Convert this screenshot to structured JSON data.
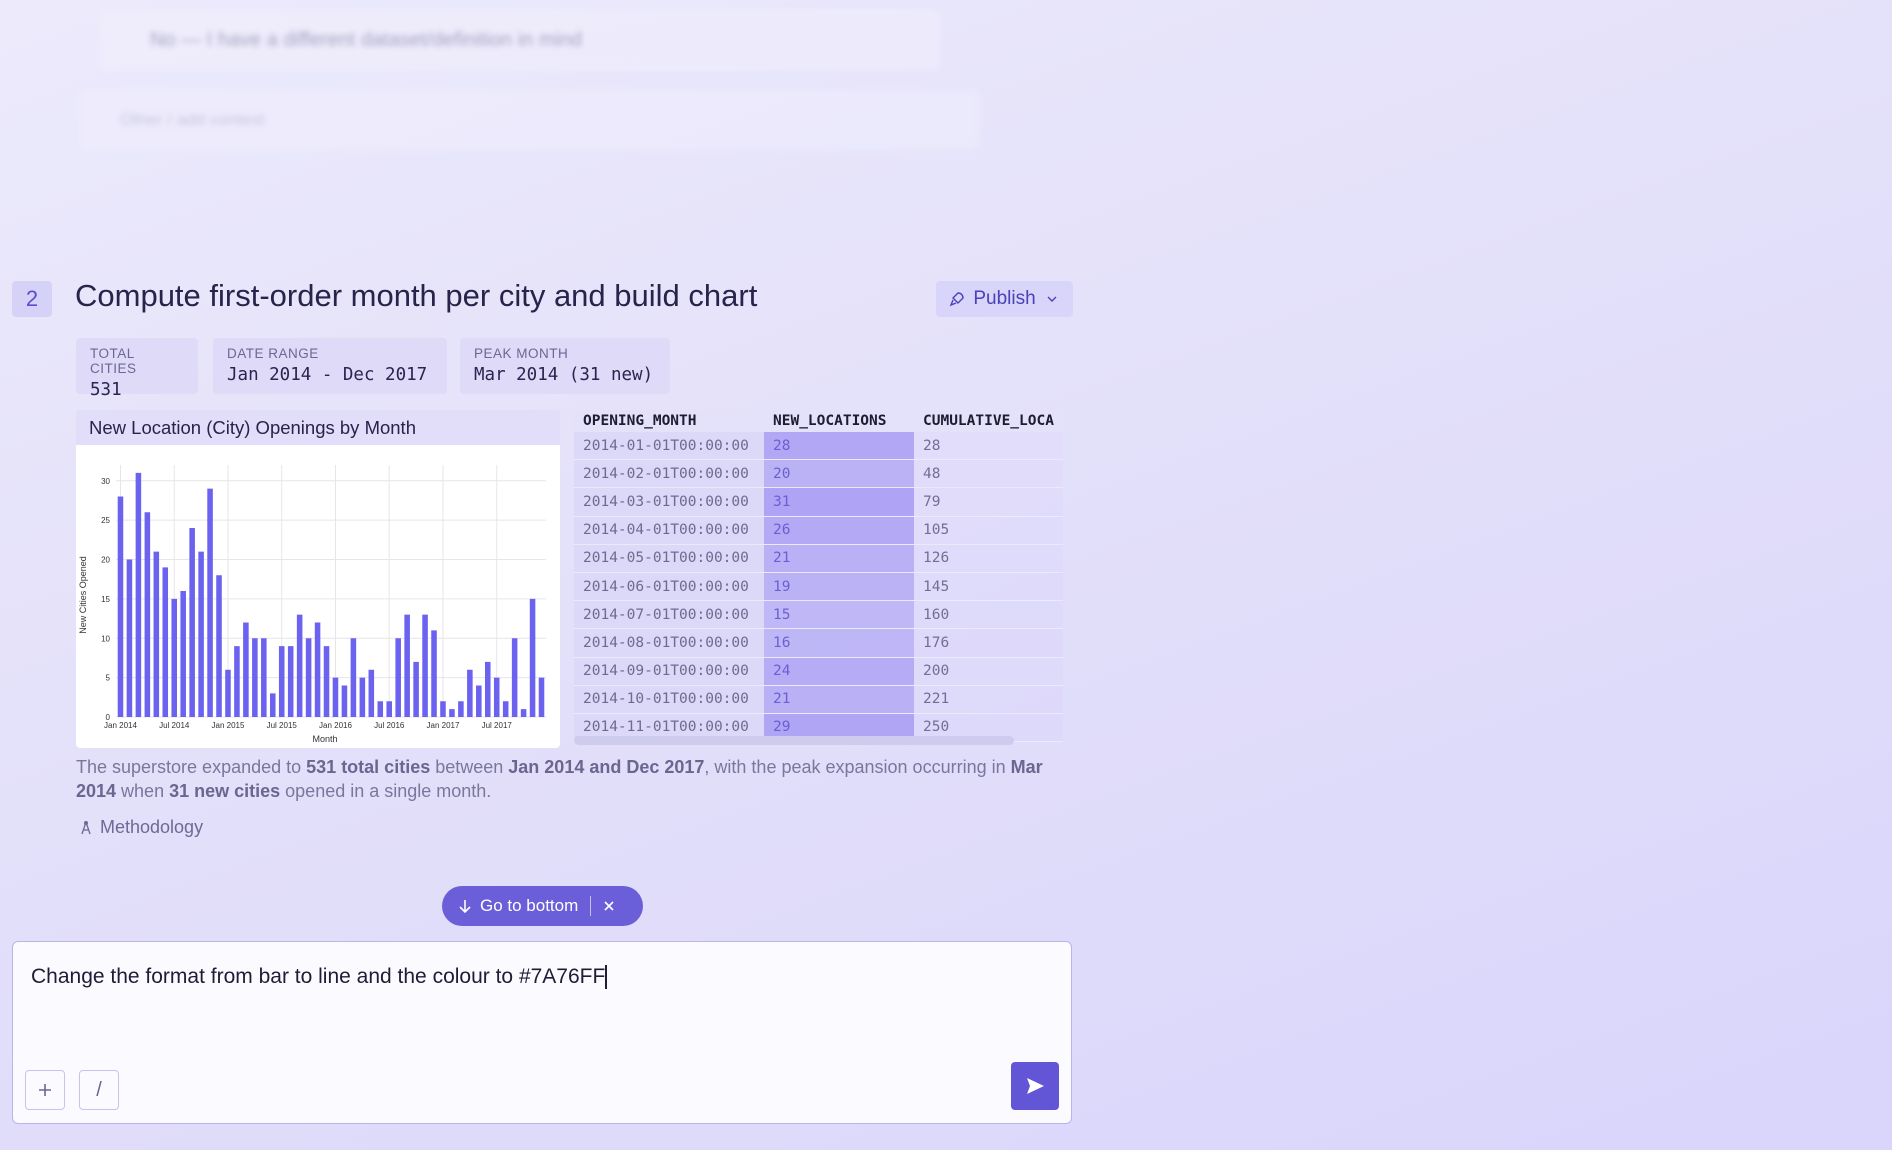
{
  "background": {
    "option_text": "No — I have a different dataset/definition in mind",
    "other_text": "Other / add context"
  },
  "step": {
    "number": "2",
    "title": "Compute first-order month per city and build chart",
    "publish_label": "Publish"
  },
  "stats": [
    {
      "label": "TOTAL CITIES",
      "value": "531"
    },
    {
      "label": "DATE RANGE",
      "value": "Jan 2014 - Dec 2017"
    },
    {
      "label": "PEAK MONTH",
      "value": "Mar 2014 (31 new)"
    }
  ],
  "chart_title": "New Location (City) Openings by Month",
  "chart_data": {
    "type": "bar",
    "title": "New Location (City) Openings by Month",
    "xlabel": "Month",
    "ylabel": "New Cities Opened",
    "ylim": [
      0,
      32
    ],
    "yticks": [
      0,
      5,
      10,
      15,
      20,
      25,
      30
    ],
    "xticks": [
      "Jan 2014",
      "Jul 2014",
      "Jan 2015",
      "Jul 2015",
      "Jan 2016",
      "Jul 2016",
      "Jan 2017",
      "Jul 2017"
    ],
    "values": [
      28,
      20,
      31,
      26,
      21,
      19,
      15,
      16,
      24,
      21,
      29,
      18,
      6,
      9,
      12,
      10,
      10,
      3,
      9,
      9,
      13,
      10,
      12,
      9,
      5,
      4,
      10,
      5,
      6,
      2,
      2,
      10,
      13,
      7,
      13,
      11,
      2,
      1,
      2,
      6,
      4,
      7,
      5,
      2,
      10,
      1,
      15,
      5
    ],
    "bar_color": "#6b63f0",
    "grid": true
  },
  "table": {
    "headers": [
      "OPENING_MONTH",
      "NEW_LOCATIONS",
      "CUMULATIVE_LOCA"
    ],
    "rows": [
      [
        "2014-01-01T00:00:00",
        "28",
        "28"
      ],
      [
        "2014-02-01T00:00:00",
        "20",
        "48"
      ],
      [
        "2014-03-01T00:00:00",
        "31",
        "79"
      ],
      [
        "2014-04-01T00:00:00",
        "26",
        "105"
      ],
      [
        "2014-05-01T00:00:00",
        "21",
        "126"
      ],
      [
        "2014-06-01T00:00:00",
        "19",
        "145"
      ],
      [
        "2014-07-01T00:00:00",
        "15",
        "160"
      ],
      [
        "2014-08-01T00:00:00",
        "16",
        "176"
      ],
      [
        "2014-09-01T00:00:00",
        "24",
        "200"
      ],
      [
        "2014-10-01T00:00:00",
        "21",
        "221"
      ],
      [
        "2014-11-01T00:00:00",
        "29",
        "250"
      ]
    ]
  },
  "summary": {
    "t1": "The superstore expanded to ",
    "b1": "531 total cities",
    "t2": " between ",
    "b2": "Jan 2014 and Dec 2017",
    "t3": ", with the peak expansion occurring in ",
    "b3": "Mar 2014",
    "t4": " when ",
    "b4": "31 new cities",
    "t5": " opened in a single month."
  },
  "methodology_label": "Methodology",
  "go_to_bottom_label": "Go to bottom",
  "composer": {
    "text": "Change the format from bar to line and the colour to #7A76FF",
    "slash_label": "/"
  }
}
